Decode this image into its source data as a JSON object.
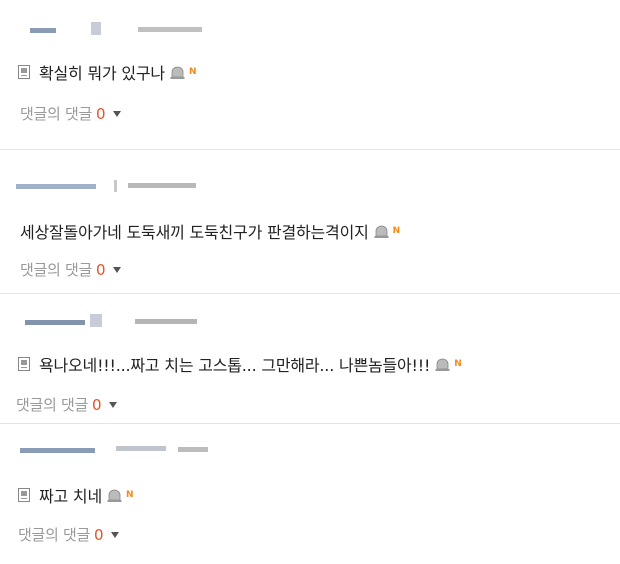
{
  "comments": [
    {
      "text": "확실히 뭐가 있구나",
      "reply_label": "댓글의 댓글",
      "reply_count": "0",
      "new_badge": "N",
      "icons": [
        "document-icon",
        "alarm-icon"
      ]
    },
    {
      "text": "세상잘돌아가네 도둑새끼 도둑친구가 판결하는격이지",
      "reply_label": "댓글의 댓글",
      "reply_count": "0",
      "new_badge": "N",
      "icons": [
        "alarm-icon"
      ]
    },
    {
      "text": "욕나오네!!!...짜고 치는 고스톱... 그만해라... 나쁜놈들아!!!",
      "reply_label": "댓글의 댓글",
      "reply_count": "0",
      "new_badge": "N",
      "icons": [
        "document-icon",
        "alarm-icon"
      ]
    },
    {
      "text": "짜고 치네",
      "reply_label": "댓글의 댓글",
      "reply_count": "0",
      "new_badge": "N",
      "icons": [
        "document-icon",
        "alarm-icon"
      ]
    }
  ],
  "colors": {
    "text": "#222222",
    "muted": "#9a9a9a",
    "count": "#e0532b",
    "badge": "#f28a1c",
    "divider": "#e4e4e4"
  }
}
